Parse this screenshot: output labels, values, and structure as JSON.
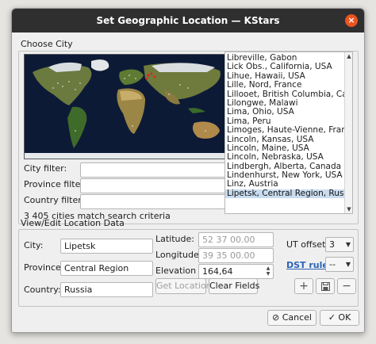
{
  "window": {
    "title": "Set Geographic Location — KStars"
  },
  "choose_city": {
    "group_title": "Choose City",
    "city_filter_label": "City filter:",
    "province_filter_label": "Province filter:",
    "country_filter_label": "Country filter:",
    "city_filter_value": "",
    "province_filter_value": "",
    "country_filter_value": "",
    "match_count_text": "3 405 cities match search criteria",
    "cities": [
      "Libreville, Gabon",
      "Lick Obs., California, USA",
      "Lihue, Hawaii, USA",
      "Lille, Nord, France",
      "Lillooet, British Columbia, Canada",
      "Lilongwe, Malawi",
      "Lima, Ohio, USA",
      "Lima, Peru",
      "Limoges, Haute-Vienne, France",
      "Lincoln, Kansas, USA",
      "Lincoln, Maine, USA",
      "Lincoln, Nebraska, USA",
      "Lindbergh, Alberta, Canada",
      "Lindenhurst, New York, USA",
      "Linz, Austria",
      "Lipetsk, Central Region, Russia"
    ],
    "selected_city": "Lipetsk, Central Region, Russia"
  },
  "location_data": {
    "group_title": "View/Edit Location Data",
    "city_label": "City:",
    "city_value": "Lipetsk",
    "province_label": "Province:",
    "province_value": "Central Region",
    "country_label": "Country:",
    "country_value": "Russia",
    "latitude_label": "Latitude:",
    "latitude_value": "52 37 00.00",
    "longitude_label": "Longitude:",
    "longitude_value": "39 35 00.00",
    "elevation_label": "Elevation",
    "elevation_value": "164,64",
    "get_location_label": "Get Location",
    "clear_fields_label": "Clear Fields",
    "ut_offset_label": "UT offset:",
    "ut_offset_value": "3",
    "dst_rule_label": "DST rule:",
    "dst_rule_value": "--"
  },
  "buttons": {
    "cancel_label": "Cancel",
    "ok_label": "OK"
  },
  "colors": {
    "title_bar": "#2f2f2f",
    "close_button": "#e95420",
    "selection": "#c9dcef",
    "link": "#2a63b8"
  },
  "icons": {
    "close": "close-icon",
    "add": "plus-icon",
    "save": "save-icon",
    "remove": "minus-icon",
    "cancel": "cancel-icon",
    "ok": "check-icon"
  }
}
